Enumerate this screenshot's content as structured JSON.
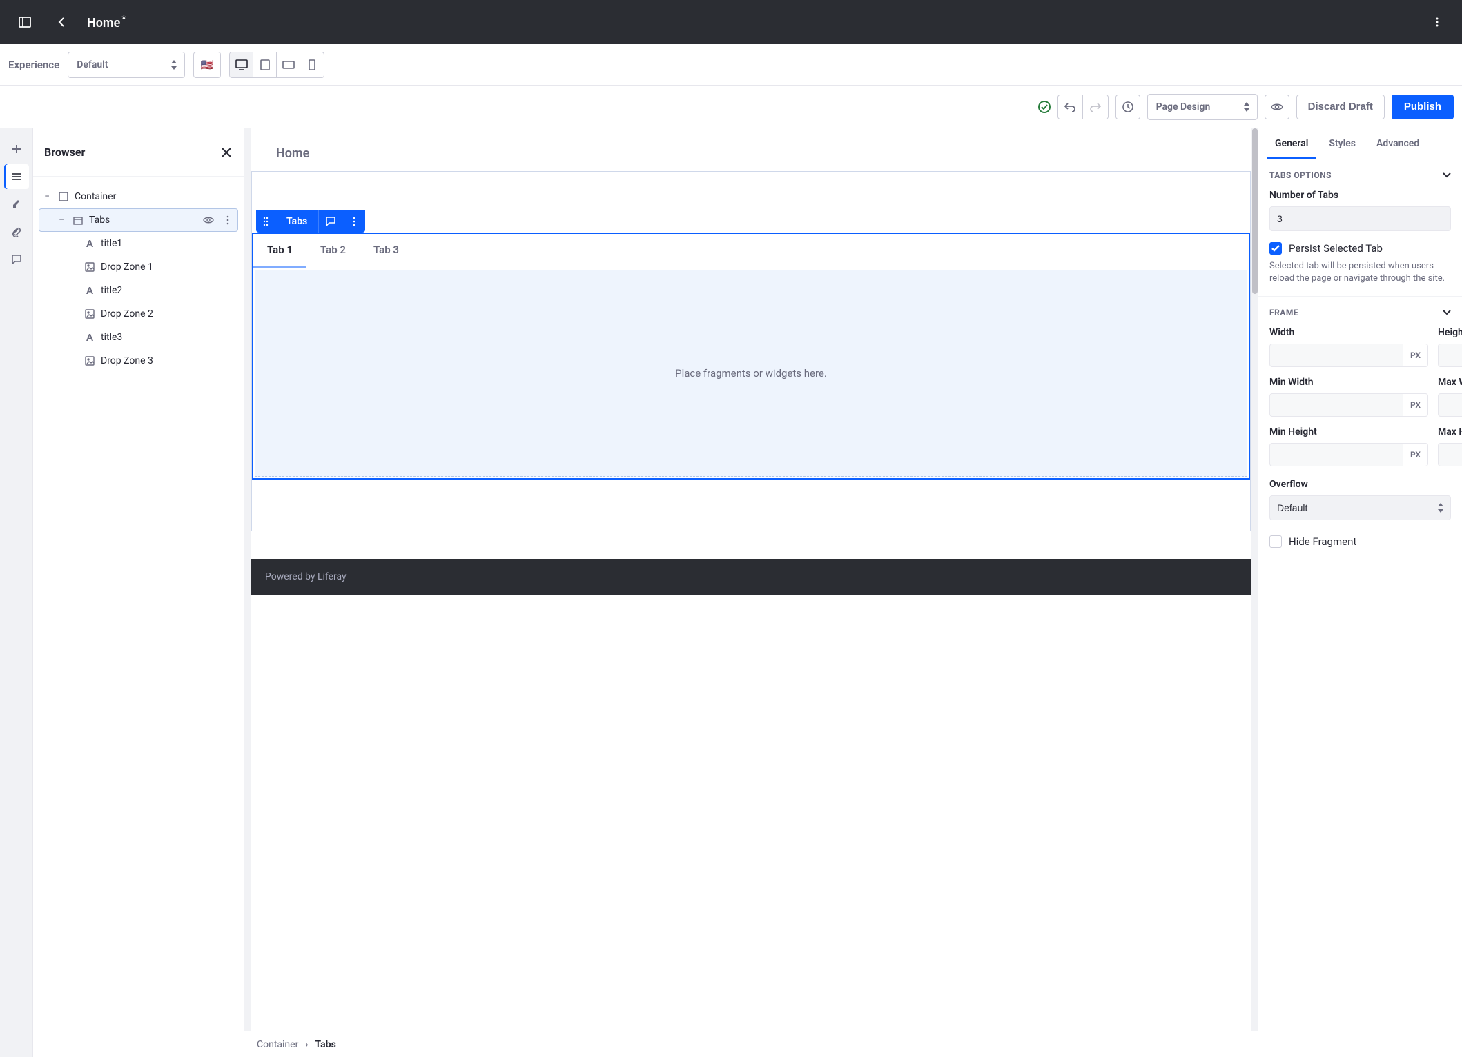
{
  "topbar": {
    "title": "Home",
    "modified": "*"
  },
  "experience": {
    "label": "Experience",
    "value": "Default"
  },
  "actionbar": {
    "page_mode": "Page Design",
    "discard": "Discard Draft",
    "publish": "Publish"
  },
  "browser": {
    "title": "Browser",
    "tree": {
      "container": "Container",
      "tabs": "Tabs",
      "title1": "title1",
      "dz1": "Drop Zone 1",
      "title2": "title2",
      "dz2": "Drop Zone 2",
      "title3": "title3",
      "dz3": "Drop Zone 3"
    }
  },
  "canvas": {
    "page_title": "Home",
    "fragment_label": "Tabs",
    "tabs": {
      "t1": "Tab 1",
      "t2": "Tab 2",
      "t3": "Tab 3"
    },
    "dropzone_text": "Place fragments or widgets here.",
    "footer": "Powered by Liferay"
  },
  "breadcrumb": {
    "container": "Container",
    "current": "Tabs",
    "sep": "›"
  },
  "sidebar": {
    "tabs": {
      "general": "General",
      "styles": "Styles",
      "advanced": "Advanced"
    },
    "tabs_options": {
      "header": "TABS OPTIONS",
      "num_label": "Number of Tabs",
      "num_value": "3",
      "persist_label": "Persist Selected Tab",
      "persist_help": "Selected tab will be persisted when users reload the page or navigate through the site."
    },
    "frame": {
      "header": "FRAME",
      "width": "Width",
      "height": "Height",
      "min_width": "Min Width",
      "max_width": "Max Width",
      "min_height": "Min Height",
      "max_height": "Max Height",
      "unit": "PX",
      "overflow_label": "Overflow",
      "overflow_value": "Default",
      "hide_fragment": "Hide Fragment"
    }
  }
}
